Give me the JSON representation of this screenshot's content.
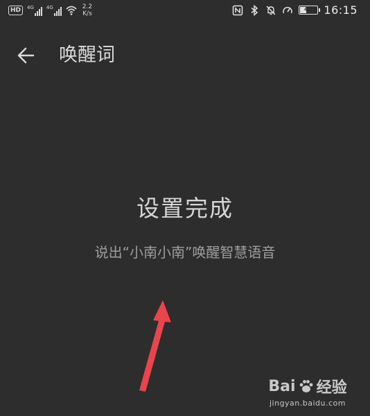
{
  "status_bar": {
    "hd_label": "HD",
    "network_labels": [
      "4G",
      "4G"
    ],
    "speed_value": "2.2",
    "speed_unit": "K/s",
    "battery_level": "41",
    "time": "16:15",
    "icons": [
      "nfc-icon",
      "bluetooth-icon",
      "mute-bell-icon",
      "speedometer-icon",
      "battery-icon"
    ]
  },
  "header": {
    "back_icon": "back-arrow-icon",
    "title": "唤醒词"
  },
  "main": {
    "heading": "设置完成",
    "subtext": "说出“小南小南”唤醒智慧语音"
  },
  "annotation": {
    "arrow_color": "#e8454d"
  },
  "watermark": {
    "logo_left": "Bai",
    "logo_right": "经验",
    "url": "jingyan.baidu.com"
  }
}
